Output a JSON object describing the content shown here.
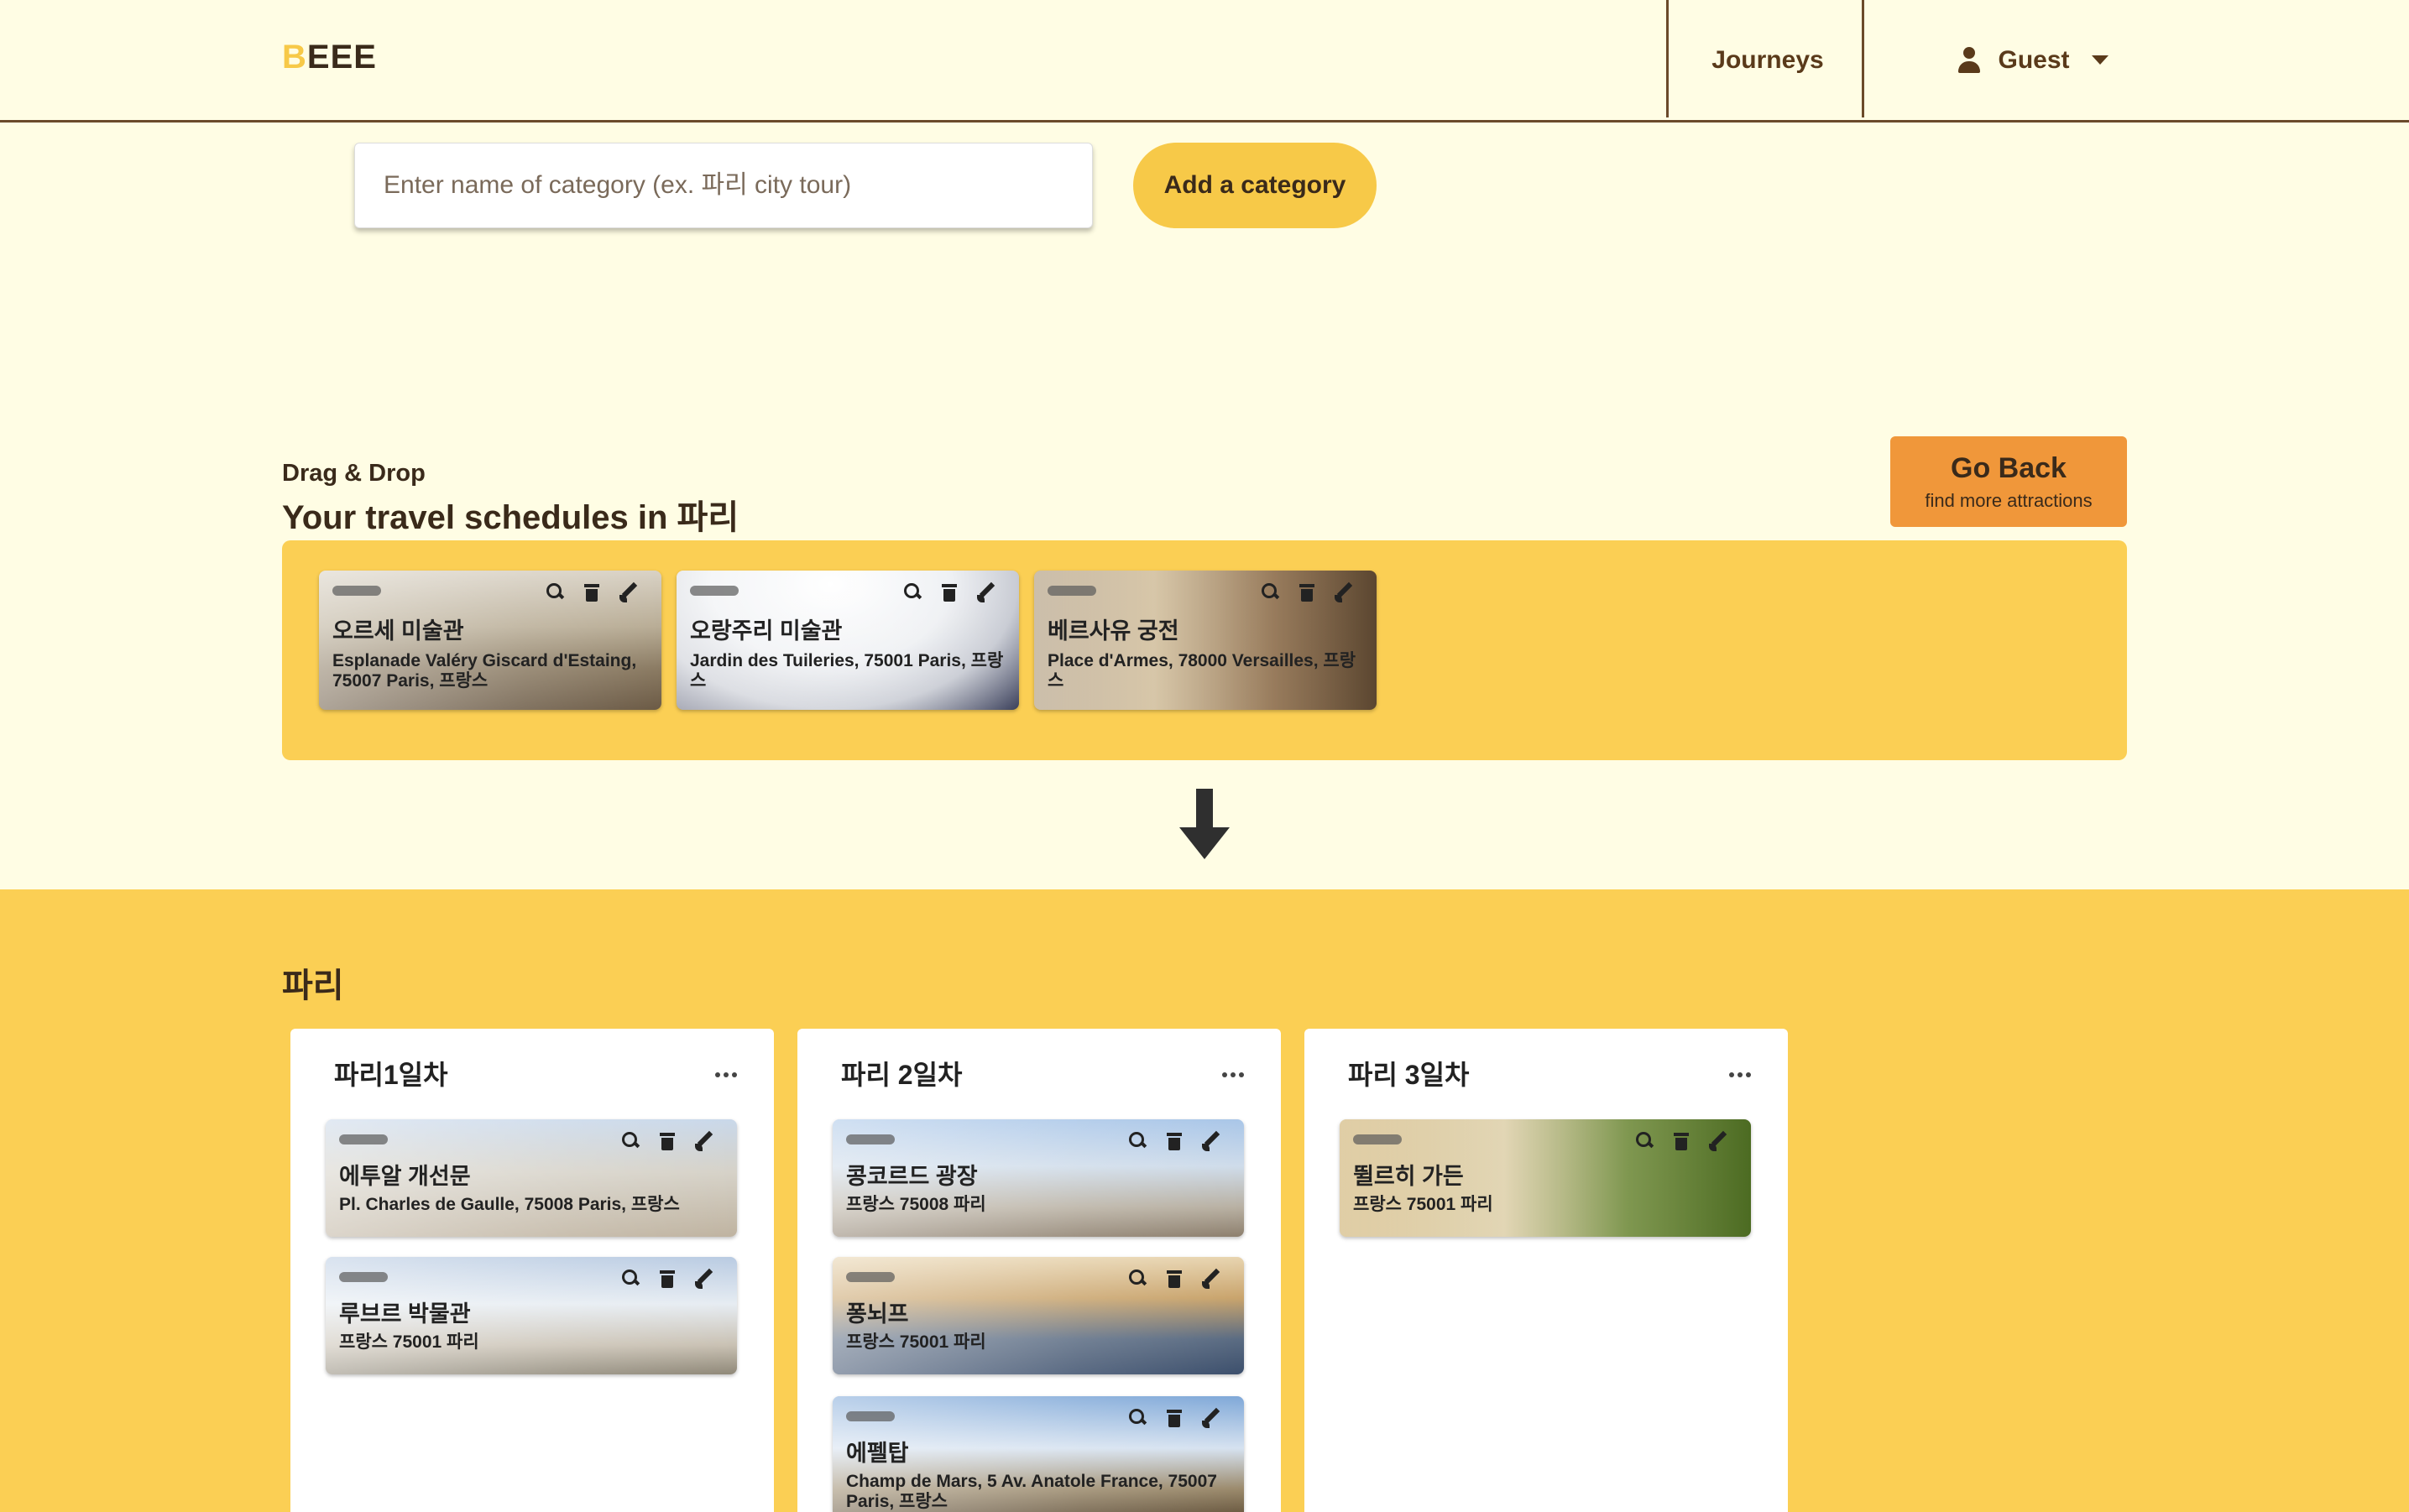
{
  "header": {
    "logo_first": "B",
    "logo_rest": "EEE",
    "nav_journeys": "Journeys",
    "user_name": "Guest"
  },
  "category": {
    "placeholder": "Enter name of category (ex. 파리 city tour)",
    "add_label": "Add a category"
  },
  "schedules": {
    "label": "Drag & Drop",
    "title": "Your travel schedules in 파리",
    "go_back_main": "Go Back",
    "go_back_sub": "find more attractions",
    "cards": [
      {
        "name": "오르세 미술관",
        "address": "Esplanade Valéry Giscard d'Estaing, 75007 Paris, 프랑스"
      },
      {
        "name": "오랑주리 미술관",
        "address": "Jardin des Tuileries, 75001 Paris, 프랑스"
      },
      {
        "name": "베르사유 궁전",
        "address": "Place d'Armes, 78000 Versailles, 프랑스"
      }
    ]
  },
  "board": {
    "title": "파리",
    "days": [
      {
        "title": "파리1일차",
        "cards": [
          {
            "name": "에투알 개선문",
            "address": "Pl. Charles de Gaulle, 75008 Paris, 프랑스"
          },
          {
            "name": "루브르 박물관",
            "address": "프랑스 75001 파리"
          }
        ]
      },
      {
        "title": "파리 2일차",
        "cards": [
          {
            "name": "콩코르드 광장",
            "address": "프랑스 75008 파리"
          },
          {
            "name": "퐁뇌프",
            "address": "프랑스 75001 파리"
          },
          {
            "name": "에펠탑",
            "address": "Champ de Mars, 5 Av. Anatole France, 75007 Paris, 프랑스"
          }
        ]
      },
      {
        "title": "파리 3일차",
        "cards": [
          {
            "name": "뛸르히 가든",
            "address": "프랑스 75001 파리"
          }
        ]
      }
    ]
  },
  "icons": [
    "user-icon",
    "caret-down-icon",
    "search-icon",
    "trash-icon",
    "brush-icon",
    "more-icon",
    "arrow-down-icon"
  ],
  "colors": {
    "accent": "#fbcf54",
    "go_back": "#f0973a",
    "page_bg": "#fffde4",
    "border": "#6b4a2a"
  }
}
